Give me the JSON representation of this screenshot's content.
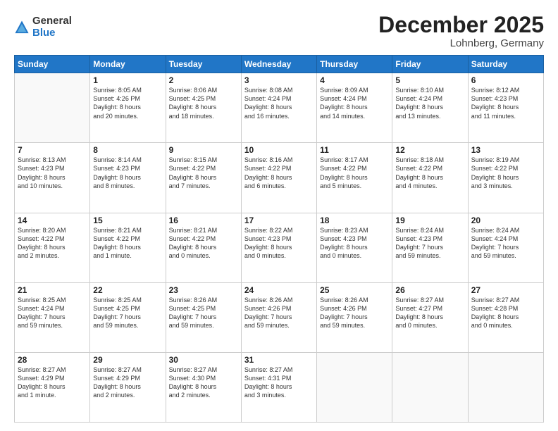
{
  "logo": {
    "general": "General",
    "blue": "Blue"
  },
  "header": {
    "month": "December 2025",
    "location": "Lohnberg, Germany"
  },
  "days": [
    "Sunday",
    "Monday",
    "Tuesday",
    "Wednesday",
    "Thursday",
    "Friday",
    "Saturday"
  ],
  "weeks": [
    [
      {
        "day": "",
        "info": ""
      },
      {
        "day": "1",
        "info": "Sunrise: 8:05 AM\nSunset: 4:26 PM\nDaylight: 8 hours\nand 20 minutes."
      },
      {
        "day": "2",
        "info": "Sunrise: 8:06 AM\nSunset: 4:25 PM\nDaylight: 8 hours\nand 18 minutes."
      },
      {
        "day": "3",
        "info": "Sunrise: 8:08 AM\nSunset: 4:24 PM\nDaylight: 8 hours\nand 16 minutes."
      },
      {
        "day": "4",
        "info": "Sunrise: 8:09 AM\nSunset: 4:24 PM\nDaylight: 8 hours\nand 14 minutes."
      },
      {
        "day": "5",
        "info": "Sunrise: 8:10 AM\nSunset: 4:24 PM\nDaylight: 8 hours\nand 13 minutes."
      },
      {
        "day": "6",
        "info": "Sunrise: 8:12 AM\nSunset: 4:23 PM\nDaylight: 8 hours\nand 11 minutes."
      }
    ],
    [
      {
        "day": "7",
        "info": "Sunrise: 8:13 AM\nSunset: 4:23 PM\nDaylight: 8 hours\nand 10 minutes."
      },
      {
        "day": "8",
        "info": "Sunrise: 8:14 AM\nSunset: 4:23 PM\nDaylight: 8 hours\nand 8 minutes."
      },
      {
        "day": "9",
        "info": "Sunrise: 8:15 AM\nSunset: 4:22 PM\nDaylight: 8 hours\nand 7 minutes."
      },
      {
        "day": "10",
        "info": "Sunrise: 8:16 AM\nSunset: 4:22 PM\nDaylight: 8 hours\nand 6 minutes."
      },
      {
        "day": "11",
        "info": "Sunrise: 8:17 AM\nSunset: 4:22 PM\nDaylight: 8 hours\nand 5 minutes."
      },
      {
        "day": "12",
        "info": "Sunrise: 8:18 AM\nSunset: 4:22 PM\nDaylight: 8 hours\nand 4 minutes."
      },
      {
        "day": "13",
        "info": "Sunrise: 8:19 AM\nSunset: 4:22 PM\nDaylight: 8 hours\nand 3 minutes."
      }
    ],
    [
      {
        "day": "14",
        "info": "Sunrise: 8:20 AM\nSunset: 4:22 PM\nDaylight: 8 hours\nand 2 minutes."
      },
      {
        "day": "15",
        "info": "Sunrise: 8:21 AM\nSunset: 4:22 PM\nDaylight: 8 hours\nand 1 minute."
      },
      {
        "day": "16",
        "info": "Sunrise: 8:21 AM\nSunset: 4:22 PM\nDaylight: 8 hours\nand 0 minutes."
      },
      {
        "day": "17",
        "info": "Sunrise: 8:22 AM\nSunset: 4:23 PM\nDaylight: 8 hours\nand 0 minutes."
      },
      {
        "day": "18",
        "info": "Sunrise: 8:23 AM\nSunset: 4:23 PM\nDaylight: 8 hours\nand 0 minutes."
      },
      {
        "day": "19",
        "info": "Sunrise: 8:24 AM\nSunset: 4:23 PM\nDaylight: 7 hours\nand 59 minutes."
      },
      {
        "day": "20",
        "info": "Sunrise: 8:24 AM\nSunset: 4:24 PM\nDaylight: 7 hours\nand 59 minutes."
      }
    ],
    [
      {
        "day": "21",
        "info": "Sunrise: 8:25 AM\nSunset: 4:24 PM\nDaylight: 7 hours\nand 59 minutes."
      },
      {
        "day": "22",
        "info": "Sunrise: 8:25 AM\nSunset: 4:25 PM\nDaylight: 7 hours\nand 59 minutes."
      },
      {
        "day": "23",
        "info": "Sunrise: 8:26 AM\nSunset: 4:25 PM\nDaylight: 7 hours\nand 59 minutes."
      },
      {
        "day": "24",
        "info": "Sunrise: 8:26 AM\nSunset: 4:26 PM\nDaylight: 7 hours\nand 59 minutes."
      },
      {
        "day": "25",
        "info": "Sunrise: 8:26 AM\nSunset: 4:26 PM\nDaylight: 7 hours\nand 59 minutes."
      },
      {
        "day": "26",
        "info": "Sunrise: 8:27 AM\nSunset: 4:27 PM\nDaylight: 8 hours\nand 0 minutes."
      },
      {
        "day": "27",
        "info": "Sunrise: 8:27 AM\nSunset: 4:28 PM\nDaylight: 8 hours\nand 0 minutes."
      }
    ],
    [
      {
        "day": "28",
        "info": "Sunrise: 8:27 AM\nSunset: 4:29 PM\nDaylight: 8 hours\nand 1 minute."
      },
      {
        "day": "29",
        "info": "Sunrise: 8:27 AM\nSunset: 4:29 PM\nDaylight: 8 hours\nand 2 minutes."
      },
      {
        "day": "30",
        "info": "Sunrise: 8:27 AM\nSunset: 4:30 PM\nDaylight: 8 hours\nand 2 minutes."
      },
      {
        "day": "31",
        "info": "Sunrise: 8:27 AM\nSunset: 4:31 PM\nDaylight: 8 hours\nand 3 minutes."
      },
      {
        "day": "",
        "info": ""
      },
      {
        "day": "",
        "info": ""
      },
      {
        "day": "",
        "info": ""
      }
    ]
  ]
}
